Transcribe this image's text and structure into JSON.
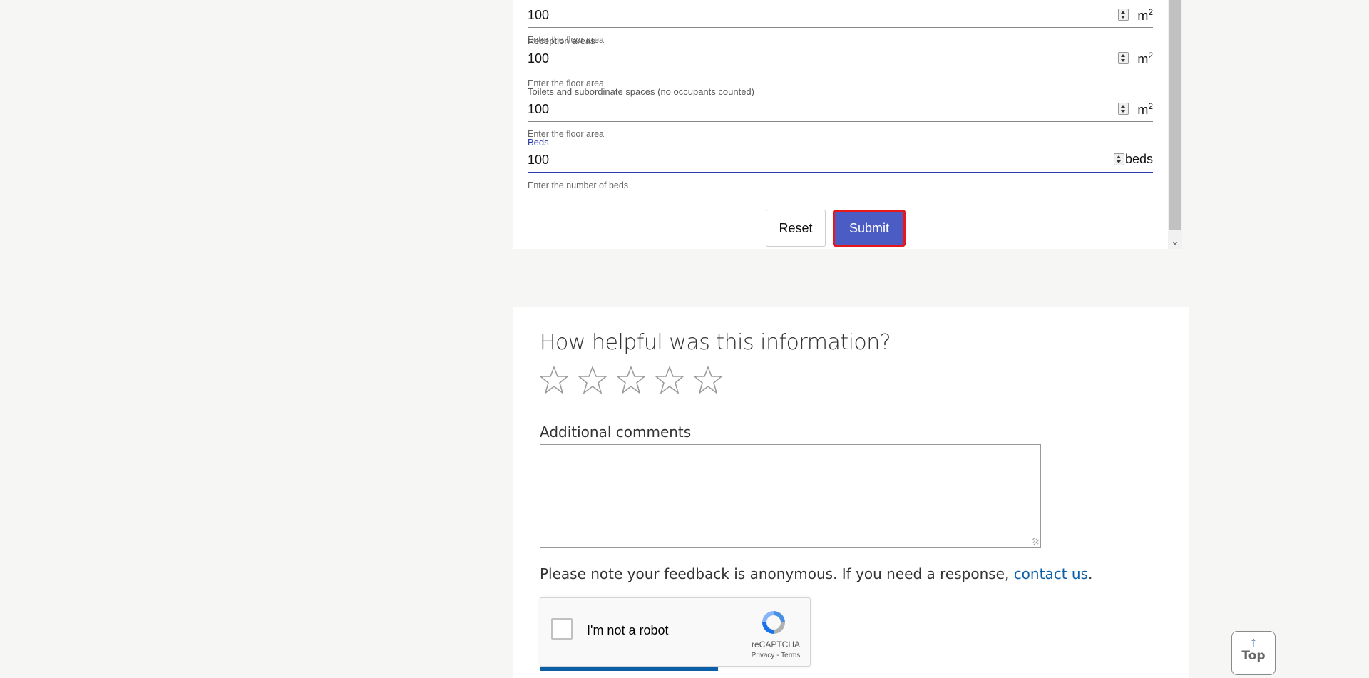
{
  "calculator": {
    "fields": [
      {
        "label": "",
        "value": "100",
        "unit": "m",
        "unit_sup": "2",
        "hint": "Enter the floor area"
      },
      {
        "label": "Reception areas",
        "value": "100",
        "unit": "m",
        "unit_sup": "2",
        "hint": "Enter the floor area"
      },
      {
        "label": "Toilets and subordinate spaces (no occupants counted)",
        "value": "100",
        "unit": "m",
        "unit_sup": "2",
        "hint": "Enter the floor area"
      },
      {
        "label": "Beds",
        "value": "100",
        "unit": "beds",
        "unit_sup": "",
        "hint": "Enter the number of beds"
      }
    ],
    "reset_label": "Reset",
    "submit_label": "Submit"
  },
  "feedback": {
    "title": "How helpful was this information?",
    "star_count": 5,
    "comments_label": "Additional comments",
    "comments_value": "",
    "note_prefix": "Please note your feedback is anonymous. If you need a response, ",
    "note_link": "contact us",
    "note_suffix": ".",
    "captcha": {
      "label": "I'm not a robot",
      "brand": "reCAPTCHA",
      "links": "Privacy - Terms"
    }
  },
  "back_to_top": {
    "label": "Top",
    "icon": "arrow-up-icon"
  },
  "colors": {
    "accent": "#2b3aa8",
    "submit_bg": "#4b5cc4",
    "focus_outline": "#e81818",
    "link": "#0b5ea8"
  }
}
